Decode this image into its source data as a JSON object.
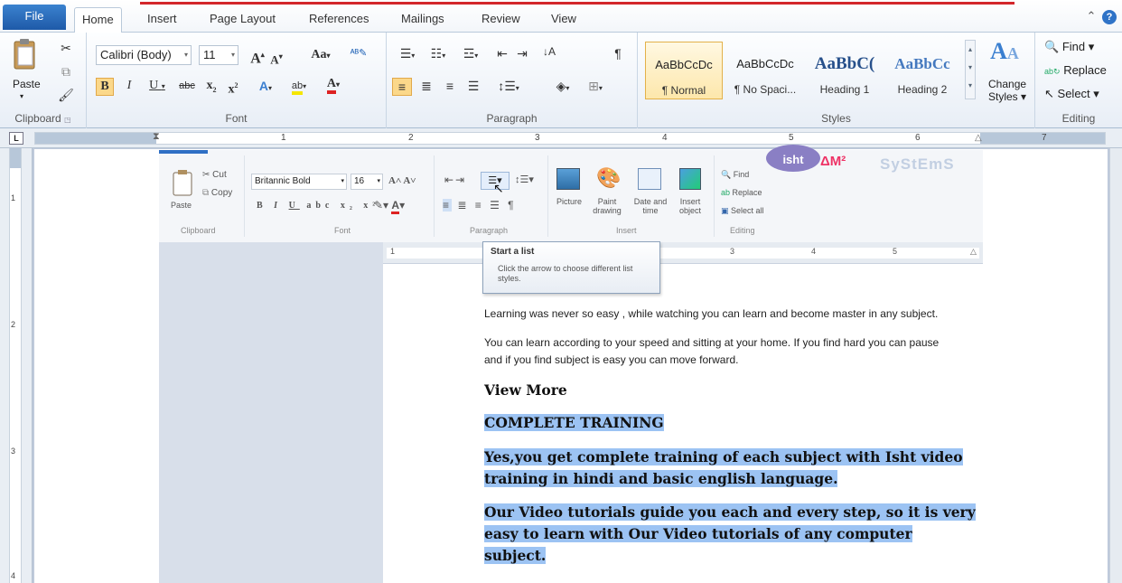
{
  "tabs": {
    "file": "File",
    "items": [
      "Home",
      "Insert",
      "Page Layout",
      "References",
      "Mailings",
      "Review",
      "View"
    ]
  },
  "ribbon": {
    "clipboard": {
      "label": "Clipboard",
      "paste": "Paste"
    },
    "font": {
      "label": "Font",
      "name": "Calibri (Body)",
      "size": "11"
    },
    "paragraph": {
      "label": "Paragraph"
    },
    "styles": {
      "label": "Styles",
      "items": [
        {
          "preview": "AaBbCcDc",
          "name": "¶ Normal"
        },
        {
          "preview": "AaBbCcDc",
          "name": "¶ No Spaci..."
        },
        {
          "preview": "AaBbC(",
          "name": "Heading 1"
        },
        {
          "preview": "AaBbCc",
          "name": "Heading 2"
        }
      ],
      "change_styles": "Change Styles ▾"
    },
    "editing": {
      "label": "Editing",
      "find": "Find ▾",
      "replace": "Replace",
      "select": "Select ▾"
    }
  },
  "ruler": {
    "numbers": [
      "1",
      "2",
      "3",
      "4",
      "5",
      "6",
      "7"
    ],
    "vnumbers": [
      "1",
      "2",
      "3",
      "4"
    ]
  },
  "embedded": {
    "clipboard": {
      "label": "Clipboard",
      "paste": "Paste",
      "cut": "Cut",
      "copy": "Copy"
    },
    "font": {
      "label": "Font",
      "name": "Britannic Bold",
      "size": "16"
    },
    "paragraph": {
      "label": "Paragraph"
    },
    "insert": {
      "label": "Insert",
      "picture": "Picture",
      "paint": "Paint drawing",
      "datetime": "Date and time",
      "object": "Insert object"
    },
    "editing": {
      "label": "Editing",
      "find": "Find",
      "replace": "Replace",
      "select_all": "Select all"
    },
    "ruler_numbers": [
      "1",
      "3",
      "4",
      "5"
    ],
    "tooltip": {
      "title": "Start a list",
      "body": "Click the arrow to choose different list styles."
    },
    "logo_left": "isht",
    "logo_right": "SyStEmS"
  },
  "document": {
    "p1": "Learning was never so easy , while watching you can learn and become master in any subject.",
    "p2a": "You can learn according to your speed and sitting at your home. If you find hard you can pause",
    "p2b": "and if you find subject is easy you can move forward.",
    "h_view_more": "View More",
    "h_complete": "COMPLETE TRAINING",
    "s1a": "Yes,you get complete training of each subject with Isht video",
    "s1b": "training in hindi and basic english language.",
    "s2a": "Our Video tutorials guide you each and every step, so it is very",
    "s2b": "easy to learn with Our Video tutorials of any computer",
    "s2c": "subject."
  }
}
